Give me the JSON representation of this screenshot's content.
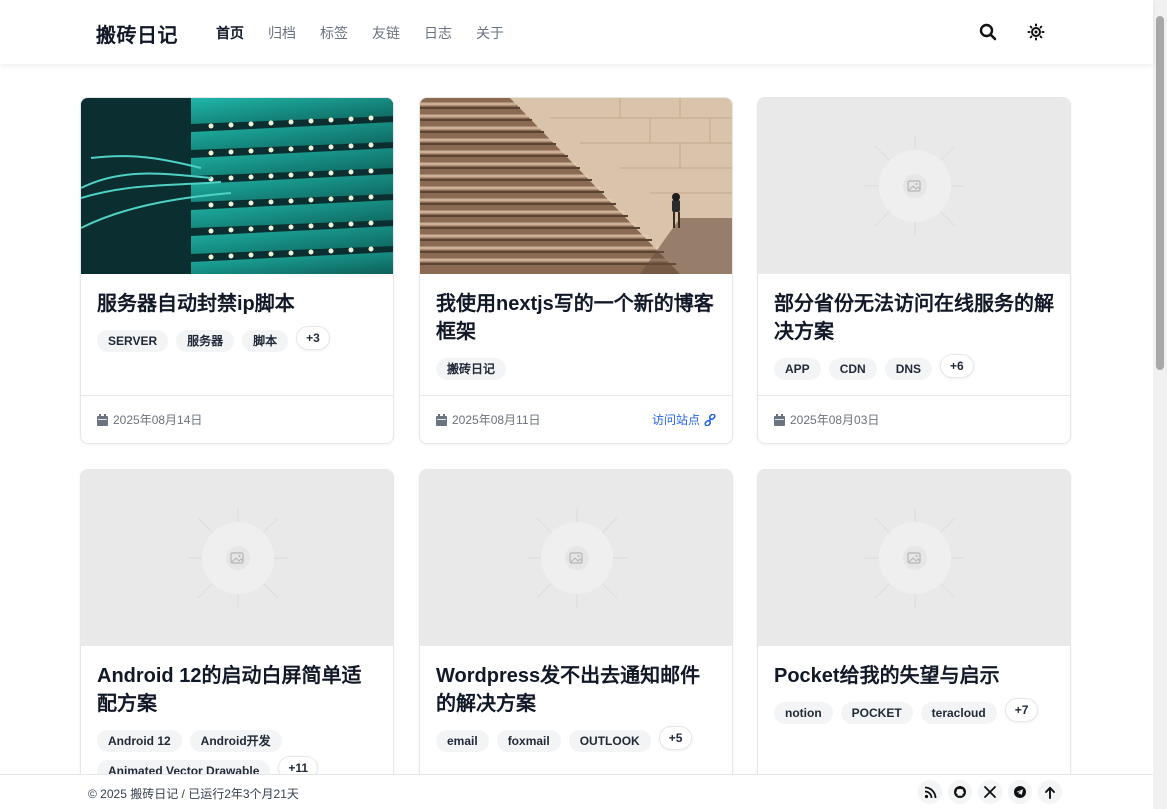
{
  "header": {
    "brand": "搬砖日记",
    "nav": [
      {
        "label": "首页",
        "active": true
      },
      {
        "label": "归档",
        "active": false
      },
      {
        "label": "标签",
        "active": false
      },
      {
        "label": "友链",
        "active": false
      },
      {
        "label": "日志",
        "active": false
      },
      {
        "label": "关于",
        "active": false
      }
    ],
    "icons": [
      "search-icon",
      "theme-toggle-icon"
    ]
  },
  "posts": [
    {
      "title": "服务器自动封禁ip脚本",
      "tags": [
        "SERVER",
        "服务器",
        "脚本"
      ],
      "more": "+3",
      "date": "2025年08月14日",
      "image": "fiber-cables-photo"
    },
    {
      "title": "我使用nextjs写的一个新的博客框架",
      "tags": [
        "搬砖日记"
      ],
      "more": "",
      "date": "2025年08月11日",
      "visit": "访问站点",
      "image": "stairs-photo"
    },
    {
      "title": "部分省份无法访问在线服务的解决方案",
      "tags": [
        "APP",
        "CDN",
        "DNS"
      ],
      "more": "+6",
      "date": "2025年08月03日",
      "image": "placeholder"
    },
    {
      "title": "Android 12的启动白屏简单适配方案",
      "tags": [
        "Android 12",
        "Android开发",
        "Animated Vector Drawable"
      ],
      "more": "+11",
      "image": "placeholder"
    },
    {
      "title": "Wordpress发不出去通知邮件的解决方案",
      "tags": [
        "email",
        "foxmail",
        "OUTLOOK"
      ],
      "more": "+5",
      "image": "placeholder"
    },
    {
      "title": "Pocket给我的失望与启示",
      "tags": [
        "notion",
        "POCKET",
        "teracloud"
      ],
      "more": "+7",
      "image": "placeholder"
    }
  ],
  "footer": {
    "copyright": "© 2025 搬砖日记 / 已运行2年3个月21天",
    "icons": [
      "rss-icon",
      "github-icon",
      "x-icon",
      "telegram-icon",
      "arrow-up-icon"
    ]
  },
  "colors": {
    "link": "#2563eb",
    "tag_bg": "#f3f4f6",
    "placeholder": "#e9e9e9",
    "cable_teal": "#14b8a6"
  }
}
